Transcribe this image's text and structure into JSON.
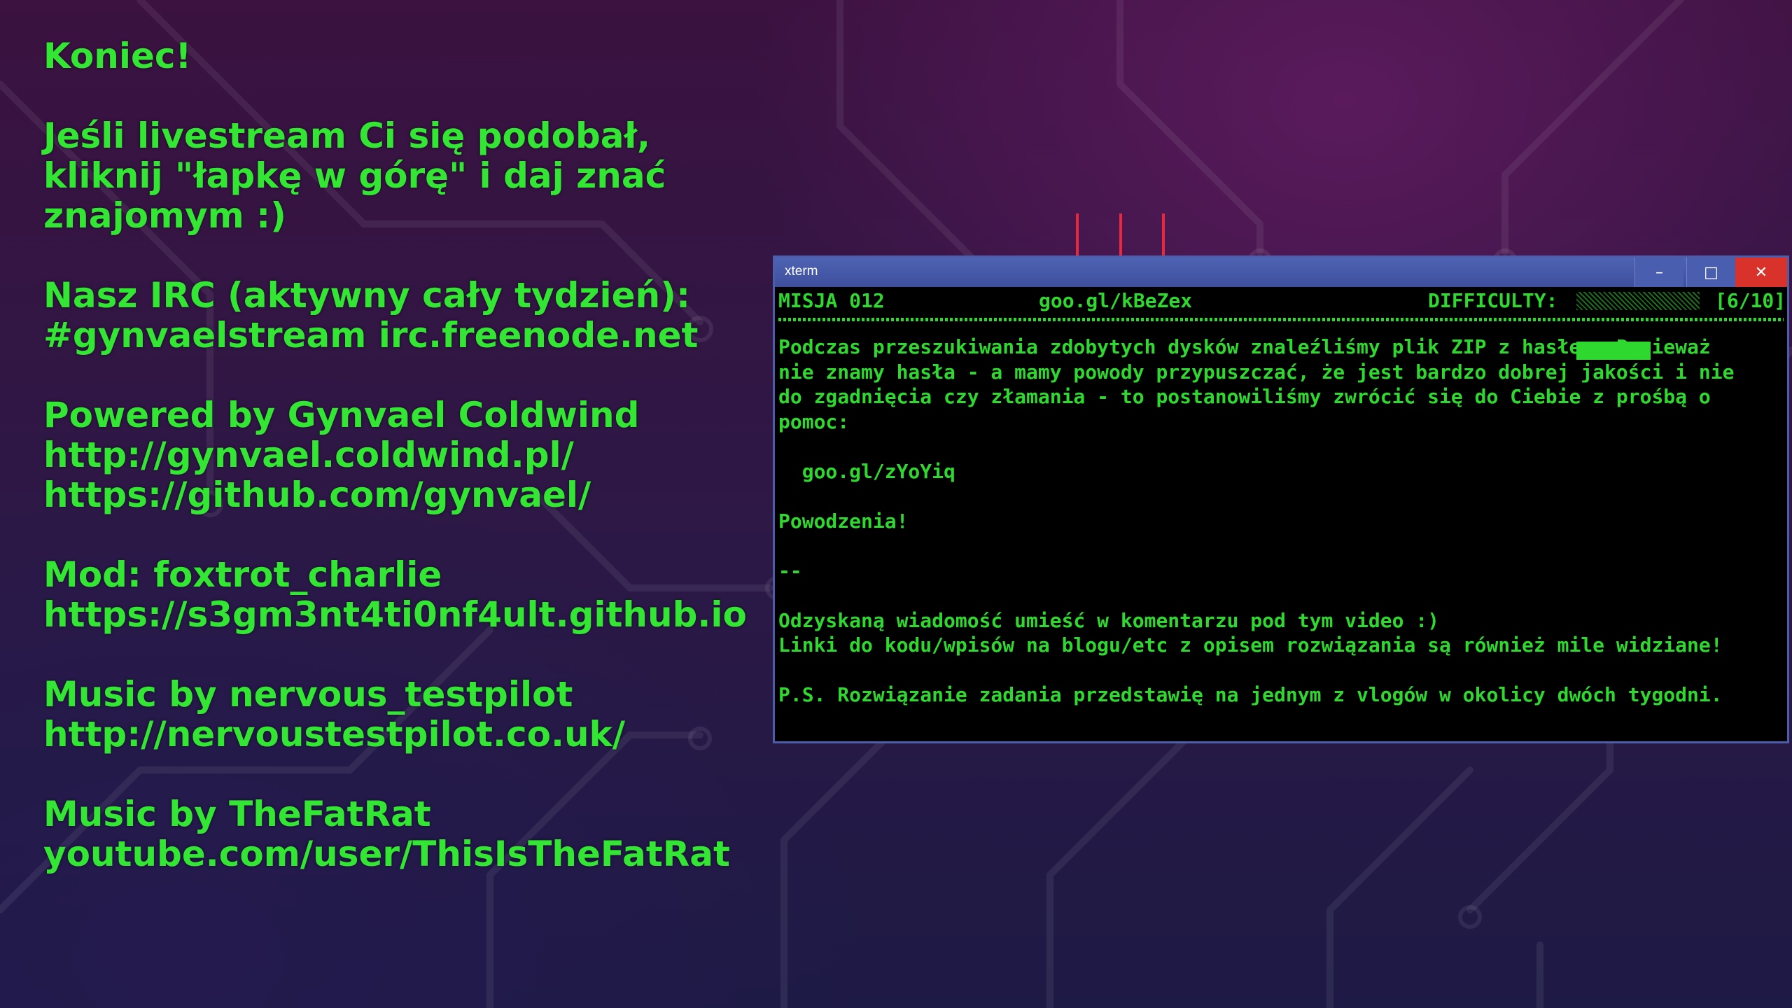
{
  "credits": {
    "blocks": [
      {
        "lines": [
          "Koniec!"
        ]
      },
      {
        "lines": [
          "Jeśli livestream Ci się podobał,",
          "kliknij \"łapkę w górę\" i daj znać",
          "znajomym :)"
        ]
      },
      {
        "lines": [
          "Nasz IRC (aktywny cały tydzień):",
          "#gynvaelstream irc.freenode.net"
        ]
      },
      {
        "lines": [
          "Powered by Gynvael Coldwind",
          "http://gynvael.coldwind.pl/",
          "https://github.com/gynvael/"
        ]
      },
      {
        "lines": [
          "Mod: foxtrot_charlie",
          "https://s3gm3nt4ti0nf4ult.github.io"
        ]
      },
      {
        "lines": [
          "Music by nervous_testpilot",
          "http://nervoustestpilot.co.uk/"
        ]
      },
      {
        "lines": [
          "Music by TheFatRat",
          "youtube.com/user/ThisIsTheFatRat"
        ]
      }
    ]
  },
  "xterm": {
    "title": "xterm",
    "buttons": {
      "minimize": "–",
      "maximize": "□",
      "close": "✕"
    },
    "header": {
      "mission": "MISJA 012",
      "url": "goo.gl/kBeZex",
      "difficulty_label": "DIFFICULTY:",
      "difficulty_value": 0.6,
      "score": "[6/10]"
    },
    "body": [
      "Podczas przeszukiwania zdobytych dysków znaleźliśmy plik ZIP z hasłem. Ponieważ",
      "nie znamy hasła - a mamy powody przypuszczać, że jest bardzo dobrej jakości i nie",
      "do zgadnięcia czy złamania - to postanowiliśmy zwrócić się do Ciebie z prośbą o",
      "pomoc:",
      "",
      "  goo.gl/zYoYiq",
      "",
      "Powodzenia!",
      "",
      "--",
      "",
      "Odzyskaną wiadomość umieść w komentarzu pod tym video :)",
      "Linki do kodu/wpisów na blogu/etc z opisem rozwiązania są również mile widziane!",
      "",
      "P.S. Rozwiązanie zadania przedstawię na jednym z vlogów w okolicy dwóch tygodni."
    ]
  },
  "colors": {
    "text_green": "#33e633",
    "terminal_green": "#2ed82e",
    "arrow_red": "#e8283c",
    "titlebar_blue": "#4b5dab"
  },
  "icons": {
    "arrows": [
      "arrow-down-icon",
      "arrow-down-icon",
      "arrow-down-icon"
    ]
  }
}
